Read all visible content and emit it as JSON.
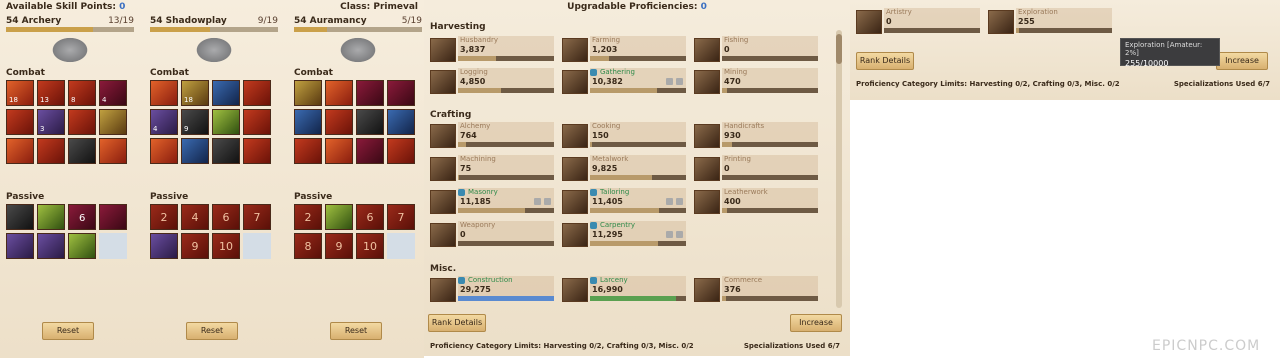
{
  "skills": {
    "points_label": "Available Skill Points:",
    "points_value": "0",
    "class_label": "Class: Primeval",
    "trees": [
      {
        "name": "54 Archery",
        "count": "13/19",
        "fill": 0.68,
        "combat_label": "Combat",
        "passive_label": "Passive",
        "reset": "Reset",
        "combat": [
          [
            "r2",
            "18"
          ],
          [
            "r1",
            "13"
          ],
          [
            "r1",
            "8"
          ],
          [
            "r7",
            "4"
          ],
          [
            "r1",
            ""
          ],
          [
            "r3",
            "3"
          ],
          [
            "r1",
            ""
          ],
          [
            "r6",
            ""
          ],
          [
            "r2",
            ""
          ],
          [
            "r1",
            ""
          ],
          [
            "r5",
            ""
          ],
          [
            "r2",
            ""
          ]
        ],
        "passive": [
          [
            "r5",
            ""
          ],
          [
            "r8",
            ""
          ],
          [
            "r7",
            "6"
          ],
          [
            "r7",
            ""
          ],
          [
            "r3",
            ""
          ],
          [
            "r3",
            ""
          ],
          [
            "r8",
            ""
          ]
        ]
      },
      {
        "name": "54 Shadowplay",
        "count": "9/19",
        "fill": 0.47,
        "combat_label": "Combat",
        "passive_label": "Passive",
        "reset": "Reset",
        "combat": [
          [
            "r2",
            ""
          ],
          [
            "r6",
            "18"
          ],
          [
            "r4",
            ""
          ],
          [
            "r1",
            ""
          ],
          [
            "r3",
            "4"
          ],
          [
            "r5",
            "9"
          ],
          [
            "r8",
            ""
          ],
          [
            "r1",
            ""
          ],
          [
            "r2",
            ""
          ],
          [
            "r4",
            ""
          ],
          [
            "r5",
            ""
          ],
          [
            "r1",
            ""
          ]
        ],
        "passive": [
          [
            "pnum",
            "2"
          ],
          [
            "pnum",
            "4"
          ],
          [
            "pnum",
            "6"
          ],
          [
            "pnum",
            "7"
          ],
          [
            "r3",
            ""
          ],
          [
            "pnum",
            "9"
          ],
          [
            "pnum",
            "10"
          ]
        ]
      },
      {
        "name": "54 Auramancy",
        "count": "5/19",
        "fill": 0.26,
        "combat_label": "Combat",
        "passive_label": "Passive",
        "reset": "Reset",
        "combat": [
          [
            "r6",
            ""
          ],
          [
            "r2",
            ""
          ],
          [
            "r7",
            ""
          ],
          [
            "r7",
            ""
          ],
          [
            "r4",
            ""
          ],
          [
            "r1",
            ""
          ],
          [
            "r5",
            ""
          ],
          [
            "r4",
            ""
          ],
          [
            "r1",
            ""
          ],
          [
            "r2",
            ""
          ],
          [
            "r7",
            ""
          ],
          [
            "r1",
            ""
          ]
        ],
        "passive": [
          [
            "pnum",
            "2"
          ],
          [
            "r8",
            ""
          ],
          [
            "pnum",
            "6"
          ],
          [
            "pnum",
            "7"
          ],
          [
            "pnum",
            "8"
          ],
          [
            "pnum",
            "9"
          ],
          [
            "pnum",
            "10"
          ]
        ]
      }
    ]
  },
  "prof": {
    "title": "Upgradable Proficiencies:",
    "title_value": "0",
    "categories": [
      "Harvesting",
      "Crafting",
      "Misc."
    ],
    "items": [
      {
        "n": "Husbandry",
        "v": "3,837",
        "f": 0.4
      },
      {
        "n": "Farming",
        "v": "1,203",
        "f": 0.2
      },
      {
        "n": "Fishing",
        "v": "0",
        "f": 0
      },
      {
        "n": "Logging",
        "v": "4,850",
        "f": 0.45
      },
      {
        "n": "Gathering",
        "v": "10,382",
        "f": 0.7,
        "on": true
      },
      {
        "n": "Mining",
        "v": "470",
        "f": 0.05
      },
      {
        "n": "Alchemy",
        "v": "764",
        "f": 0.08
      },
      {
        "n": "Cooking",
        "v": "150",
        "f": 0.02
      },
      {
        "n": "Handicrafts",
        "v": "930",
        "f": 0.1
      },
      {
        "n": "Machining",
        "v": "75",
        "f": 0.01
      },
      {
        "n": "Metalwork",
        "v": "9,825",
        "f": 0.65
      },
      {
        "n": "Printing",
        "v": "0",
        "f": 0
      },
      {
        "n": "Masonry",
        "v": "11,185",
        "f": 0.7,
        "on": true
      },
      {
        "n": "Tailoring",
        "v": "11,405",
        "f": 0.72,
        "on": true
      },
      {
        "n": "Leatherwork",
        "v": "400",
        "f": 0.05
      },
      {
        "n": "Weaponry",
        "v": "0",
        "f": 0
      },
      {
        "n": "Carpentry",
        "v": "11,295",
        "f": 0.71,
        "on": true
      },
      {
        "n": "Construction",
        "v": "29,275",
        "f": 1.0,
        "on": true,
        "c": "blue"
      },
      {
        "n": "Larceny",
        "v": "16,990",
        "f": 0.9,
        "on": true,
        "c": "green"
      },
      {
        "n": "Commerce",
        "v": "376",
        "f": 0.04
      }
    ],
    "rank_details": "Rank Details",
    "increase": "Increase",
    "limits": "Proficiency Category Limits: Harvesting 0/2, Crafting 0/3, Misc. 0/2",
    "spec": "Specializations Used 6/7"
  },
  "zoom": {
    "items": [
      {
        "n": "Artistry",
        "v": "0"
      },
      {
        "n": "Exploration",
        "v": "255"
      }
    ],
    "tooltip_title": "Exploration [Amateur: 2%]",
    "tooltip_value": "255/10000",
    "rank_details": "Rank Details",
    "increase": "Increase",
    "limits": "Proficiency Category Limits: Harvesting 0/2, Crafting 0/3, Misc. 0/2",
    "spec": "Specializations Used 6/7"
  },
  "watermark": "EPICNPC.COM"
}
